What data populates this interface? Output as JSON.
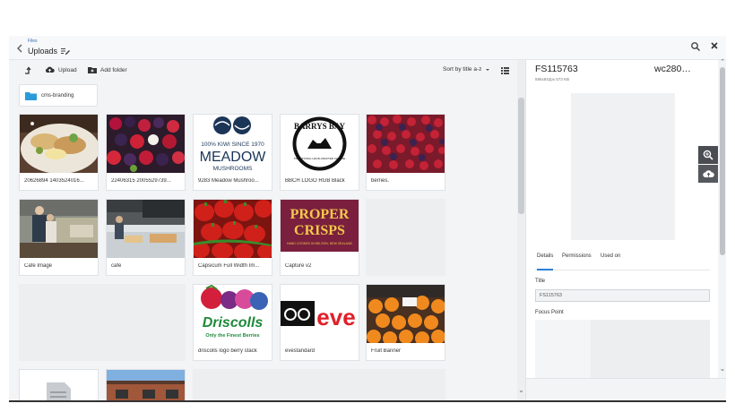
{
  "header": {
    "breadcrumb": "Files",
    "title": "Uploads"
  },
  "toolbar": {
    "upload_label": "Upload",
    "add_folder_label": "Add folder",
    "sort_label": "Sort by title a-z"
  },
  "folders": [
    {
      "name": "cms-branding"
    }
  ],
  "files": [
    {
      "name": "20626894 1403524016..."
    },
    {
      "name": "22406315 2005529739..."
    },
    {
      "name": "9283 Meadow Mushroo..."
    },
    {
      "name": "BBCH LOGO RGB Black"
    },
    {
      "name": "berries."
    },
    {
      "name": "Cafe Image"
    },
    {
      "name": "cafe"
    },
    {
      "name": "Capsicum Full Width Im..."
    },
    {
      "name": "Capture v2"
    },
    {
      "name": "driscolls logo berry stack"
    },
    {
      "name": "evestandard"
    },
    {
      "name": "Fruit Banner"
    }
  ],
  "logos": {
    "meadow_top": "100% KIWI SINCE 1970",
    "meadow_main": "MEADOW",
    "meadow_sub": "MUSHROOMS",
    "barrys": "BARRYS BAY",
    "barrys_sub": "TRADITIONAL HAND-CRAFTED CHEESE",
    "proper": "PROPER",
    "crisps": "CRISPS",
    "crisps_sub": "HAND COOKED IN NELSON, NEW ZEALAND",
    "driscolls": "Driscolls",
    "driscolls_tag": "Only the Finest Berries",
    "eve": "eve"
  },
  "details": {
    "title": "FS115763",
    "title_right": "wc280…",
    "meta": "595x842px 573 KB",
    "tabs": [
      "Details",
      "Permissions",
      "Used on"
    ],
    "title_label": "Title",
    "title_value": "FS115763",
    "focus_label": "Focus Point"
  }
}
